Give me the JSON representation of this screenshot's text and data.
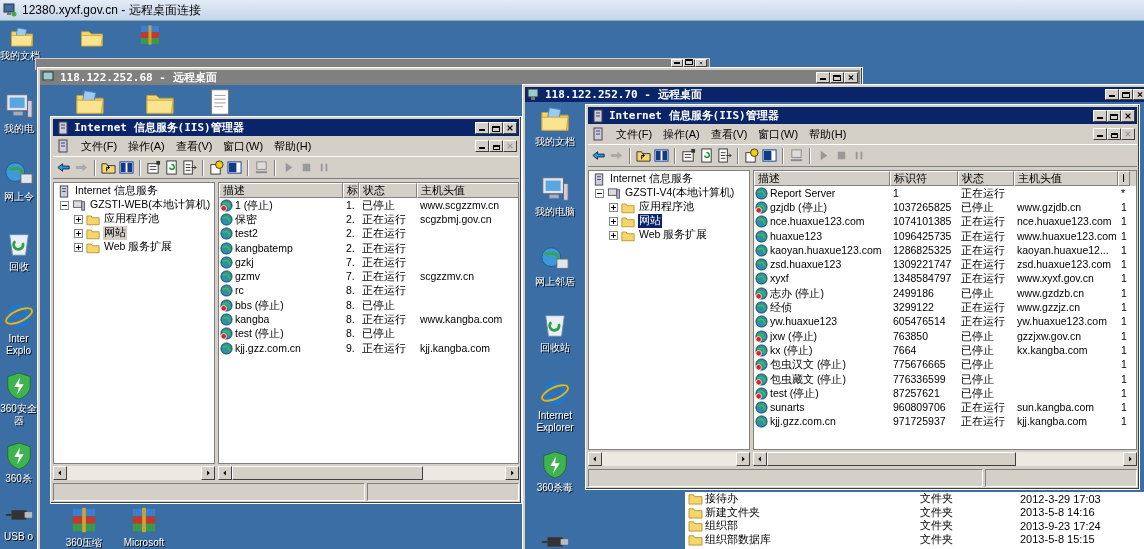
{
  "connection_window": {
    "title": "12380.xyxf.gov.cn - 远程桌面连接"
  },
  "desktop_icons": [
    {
      "kind": "docs",
      "label_lines": [
        "我的文档"
      ]
    },
    {
      "kind": "folder"
    },
    {
      "kind": "rar"
    },
    {
      "kind": "computer",
      "label_lines": [
        "我的电"
      ]
    },
    {
      "kind": "network",
      "label_lines": [
        "网上令"
      ]
    },
    {
      "kind": "recycle",
      "label_lines": [
        "回收"
      ]
    },
    {
      "kind": "ie",
      "label_lines": [
        "Inter",
        "Explo"
      ]
    },
    {
      "kind": "shield",
      "label_lines": [
        "360安全",
        "器"
      ]
    },
    {
      "kind": "shield",
      "label_lines": [
        "360杀"
      ]
    },
    {
      "kind": "usb",
      "label_lines": [
        "USB o"
      ]
    }
  ],
  "remote_windows": [
    {
      "title": "118.122.252.68 - 远程桌面",
      "active": false,
      "desktop_icons": [
        {
          "kind": "docs"
        },
        {
          "kind": "folder"
        },
        {
          "kind": "notepad"
        },
        {
          "kind": "archive",
          "label_lines": [
            "360压缩"
          ]
        },
        {
          "kind": "rar",
          "label_lines": [
            "Microsoft"
          ]
        }
      ],
      "iis": {
        "title": "Internet 信息服务(IIS)管理器",
        "menu": [
          "文件(F)",
          "操作(A)",
          "查看(V)",
          "窗口(W)",
          "帮助(H)"
        ],
        "tree": {
          "label": "Internet 信息服务",
          "selected": false,
          "children": [
            {
              "label": "GZSTI-WEB(本地计算机)",
              "expanded": true,
              "selected": false,
              "children": [
                {
                  "label": "应用程序池",
                  "expanded": false,
                  "selected": false
                },
                {
                  "label": "网站",
                  "expanded": false,
                  "selected": true
                },
                {
                  "label": "Web 服务扩展",
                  "expanded": false,
                  "selected": false
                }
              ]
            }
          ]
        },
        "columns": [
          "描述",
          "标",
          "状态",
          "主机头值"
        ],
        "rows": [
          {
            "stopped": true,
            "cells": [
              "1 (停止)",
              "1.",
              "已停止",
              "www.scgzzmv.cn"
            ]
          },
          {
            "stopped": false,
            "cells": [
              "保密",
              "2.",
              "正在运行",
              "scgzbmj.gov.cn"
            ]
          },
          {
            "stopped": false,
            "cells": [
              "test2",
              "2.",
              "正在运行"
            ]
          },
          {
            "stopped": false,
            "cells": [
              "kangbatemp",
              "2.",
              "正在运行"
            ]
          },
          {
            "stopped": false,
            "cells": [
              "gzkj",
              "7.",
              "正在运行"
            ]
          },
          {
            "stopped": false,
            "cells": [
              "gzmv",
              "7.",
              "正在运行",
              "scgzzmv.cn"
            ]
          },
          {
            "stopped": false,
            "cells": [
              "rc",
              "8.",
              "正在运行"
            ]
          },
          {
            "stopped": true,
            "cells": [
              "bbs (停止)",
              "8.",
              "已停止"
            ]
          },
          {
            "stopped": false,
            "cells": [
              "kangba",
              "8.",
              "正在运行",
              "www.kangba.com"
            ]
          },
          {
            "stopped": true,
            "cells": [
              "test (停止)",
              "8.",
              "已停止"
            ]
          },
          {
            "stopped": false,
            "cells": [
              "kjj.gzz.com.cn",
              "9.",
              "正在运行",
              "kjj.kangba.com"
            ]
          }
        ]
      }
    },
    {
      "title": "118.122.252.70 - 远程桌面",
      "active": true,
      "desktop_icons": [
        {
          "kind": "docs",
          "label_lines": [
            "我的文档"
          ]
        },
        {
          "kind": "computer",
          "label_lines": [
            "我的电脑"
          ]
        },
        {
          "kind": "network",
          "label_lines": [
            "网上邻居"
          ]
        },
        {
          "kind": "recycle",
          "label_lines": [
            "回收站"
          ]
        },
        {
          "kind": "ie",
          "label_lines": [
            "Internet",
            "Explorer"
          ]
        },
        {
          "kind": "shield",
          "label_lines": [
            "360杀毒"
          ]
        },
        {
          "kind": "usb"
        }
      ],
      "iis": {
        "title": "Internet 信息服务(IIS)管理器",
        "menu": [
          "文件(F)",
          "操作(A)",
          "查看(V)",
          "窗口(W)",
          "帮助(H)"
        ],
        "tree": {
          "label": "Internet 信息服务",
          "selected": false,
          "children": [
            {
              "label": "GZSTI-V4(本地计算机)",
              "expanded": true,
              "selected": false,
              "children": [
                {
                  "label": "应用程序池",
                  "expanded": false,
                  "selected": false
                },
                {
                  "label": "网站",
                  "expanded": false,
                  "selected": true
                },
                {
                  "label": "Web 服务扩展",
                  "expanded": false,
                  "selected": false
                }
              ]
            }
          ]
        },
        "columns": [
          "描述",
          "标识符",
          "状态",
          "主机头值",
          "I"
        ],
        "rows": [
          {
            "stopped": false,
            "cells": [
              "Report Server",
              "1",
              "正在运行",
              "",
              "*"
            ]
          },
          {
            "stopped": true,
            "cells": [
              "gzjdb (停止)",
              "1037265825",
              "已停止",
              "www.gzjdb.cn",
              "1"
            ]
          },
          {
            "stopped": false,
            "cells": [
              "nce.huaxue123.com",
              "1074101385",
              "正在运行",
              "nce.huaxue123.com",
              "1"
            ]
          },
          {
            "stopped": false,
            "cells": [
              "huaxue123",
              "1096425735",
              "正在运行",
              "www.huaxue123.com",
              "1"
            ]
          },
          {
            "stopped": false,
            "cells": [
              "kaoyan.huaxue123.com",
              "1286825325",
              "正在运行",
              "kaoyan.huaxue12...",
              "1"
            ]
          },
          {
            "stopped": false,
            "cells": [
              "zsd.huaxue123",
              "1309221747",
              "正在运行",
              "zsd.huaxue123.com",
              "1"
            ]
          },
          {
            "stopped": false,
            "cells": [
              "xyxf",
              "1348584797",
              "正在运行",
              "www.xyxf.gov.cn",
              "1"
            ]
          },
          {
            "stopped": true,
            "cells": [
              "志办 (停止)",
              "2499186",
              "已停止",
              "www.gzdzb.cn",
              "1"
            ]
          },
          {
            "stopped": false,
            "cells": [
              "经侦",
              "3299122",
              "正在运行",
              "www.gzzjz.cn",
              "1"
            ]
          },
          {
            "stopped": false,
            "cells": [
              "yw.huaxue123",
              "605476514",
              "正在运行",
              "yw.huaxue123.com",
              "1"
            ]
          },
          {
            "stopped": true,
            "cells": [
              "jxw (停止)",
              "763850",
              "已停止",
              "gzzjxw.gov.cn",
              "1"
            ]
          },
          {
            "stopped": true,
            "cells": [
              "kx (停止)",
              "7664",
              "已停止",
              "kx.kangba.com",
              "1"
            ]
          },
          {
            "stopped": true,
            "cells": [
              "包虫汉文 (停止)",
              "775676665",
              "已停止",
              "",
              "1"
            ]
          },
          {
            "stopped": true,
            "cells": [
              "包虫藏文 (停止)",
              "776336599",
              "已停止",
              "",
              "1"
            ]
          },
          {
            "stopped": true,
            "cells": [
              "test (停止)",
              "87257621",
              "已停止",
              "",
              "1"
            ]
          },
          {
            "stopped": false,
            "cells": [
              "sunarts",
              "960809706",
              "正在运行",
              "sun.kangba.com",
              "1"
            ]
          },
          {
            "stopped": false,
            "cells": [
              "kjj.gzz.com.cn",
              "971725937",
              "正在运行",
              "kjj.kangba.com",
              "1"
            ]
          }
        ]
      },
      "file_list": [
        {
          "name": "接待办",
          "type": "文件夹",
          "date": "2012-3-29 17:03"
        },
        {
          "name": "新建文件夹",
          "type": "文件夹",
          "date": "2013-5-8 14:16"
        },
        {
          "name": "组织部",
          "type": "文件夹",
          "date": "2013-9-23 17:24"
        },
        {
          "name": "组织部数据库",
          "type": "文件夹",
          "date": "2013-5-8 15:15"
        }
      ]
    }
  ]
}
